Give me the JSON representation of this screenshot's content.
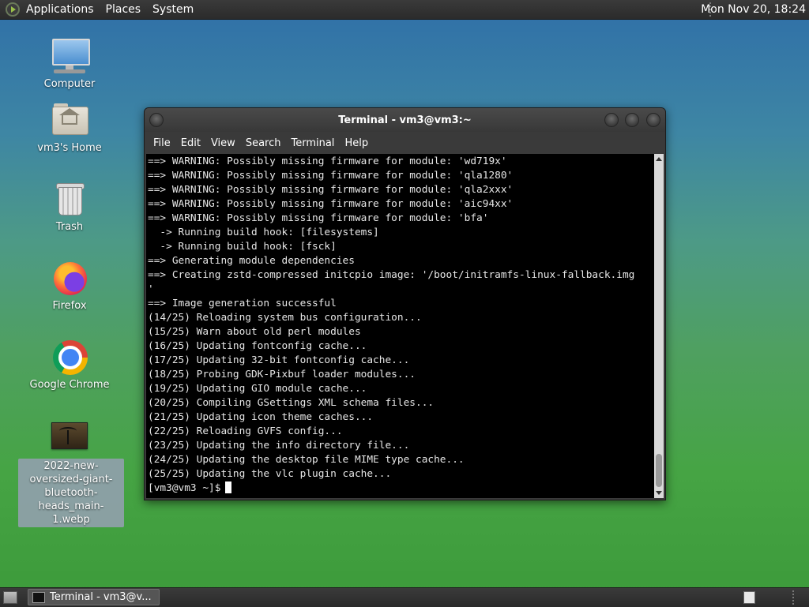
{
  "top_panel": {
    "menus": [
      "Applications",
      "Places",
      "System"
    ],
    "clock": "Mon Nov 20, 18:24"
  },
  "desktop_icons": [
    {
      "label": "Computer",
      "icon": "computer-icon"
    },
    {
      "label": "vm3's Home",
      "icon": "home-folder-icon"
    },
    {
      "label": "Trash",
      "icon": "trash-icon"
    },
    {
      "label": "Firefox",
      "icon": "firefox-icon"
    },
    {
      "label": "Google Chrome",
      "icon": "chrome-icon"
    },
    {
      "label": "2022-new-oversized-giant-bluetooth-heads_main-1.webp",
      "icon": "image-file-icon"
    }
  ],
  "terminal": {
    "title": "Terminal - vm3@vm3:~",
    "menu": [
      "File",
      "Edit",
      "View",
      "Search",
      "Terminal",
      "Help"
    ],
    "lines": [
      "==> WARNING: Possibly missing firmware for module: 'wd719x'",
      "==> WARNING: Possibly missing firmware for module: 'qla1280'",
      "==> WARNING: Possibly missing firmware for module: 'qla2xxx'",
      "==> WARNING: Possibly missing firmware for module: 'aic94xx'",
      "==> WARNING: Possibly missing firmware for module: 'bfa'",
      "  -> Running build hook: [filesystems]",
      "  -> Running build hook: [fsck]",
      "==> Generating module dependencies",
      "==> Creating zstd-compressed initcpio image: '/boot/initramfs-linux-fallback.img",
      "'",
      "==> Image generation successful",
      "(14/25) Reloading system bus configuration...",
      "(15/25) Warn about old perl modules",
      "(16/25) Updating fontconfig cache...",
      "(17/25) Updating 32-bit fontconfig cache...",
      "(18/25) Probing GDK-Pixbuf loader modules...",
      "(19/25) Updating GIO module cache...",
      "(20/25) Compiling GSettings XML schema files...",
      "(21/25) Updating icon theme caches...",
      "(22/25) Reloading GVFS config...",
      "(23/25) Updating the info directory file...",
      "(24/25) Updating the desktop file MIME type cache...",
      "(25/25) Updating the vlc plugin cache..."
    ],
    "prompt": "[vm3@vm3 ~]$"
  },
  "taskbar": {
    "tasks": [
      {
        "label": "Terminal - vm3@v...",
        "icon": "terminal-icon"
      }
    ]
  }
}
